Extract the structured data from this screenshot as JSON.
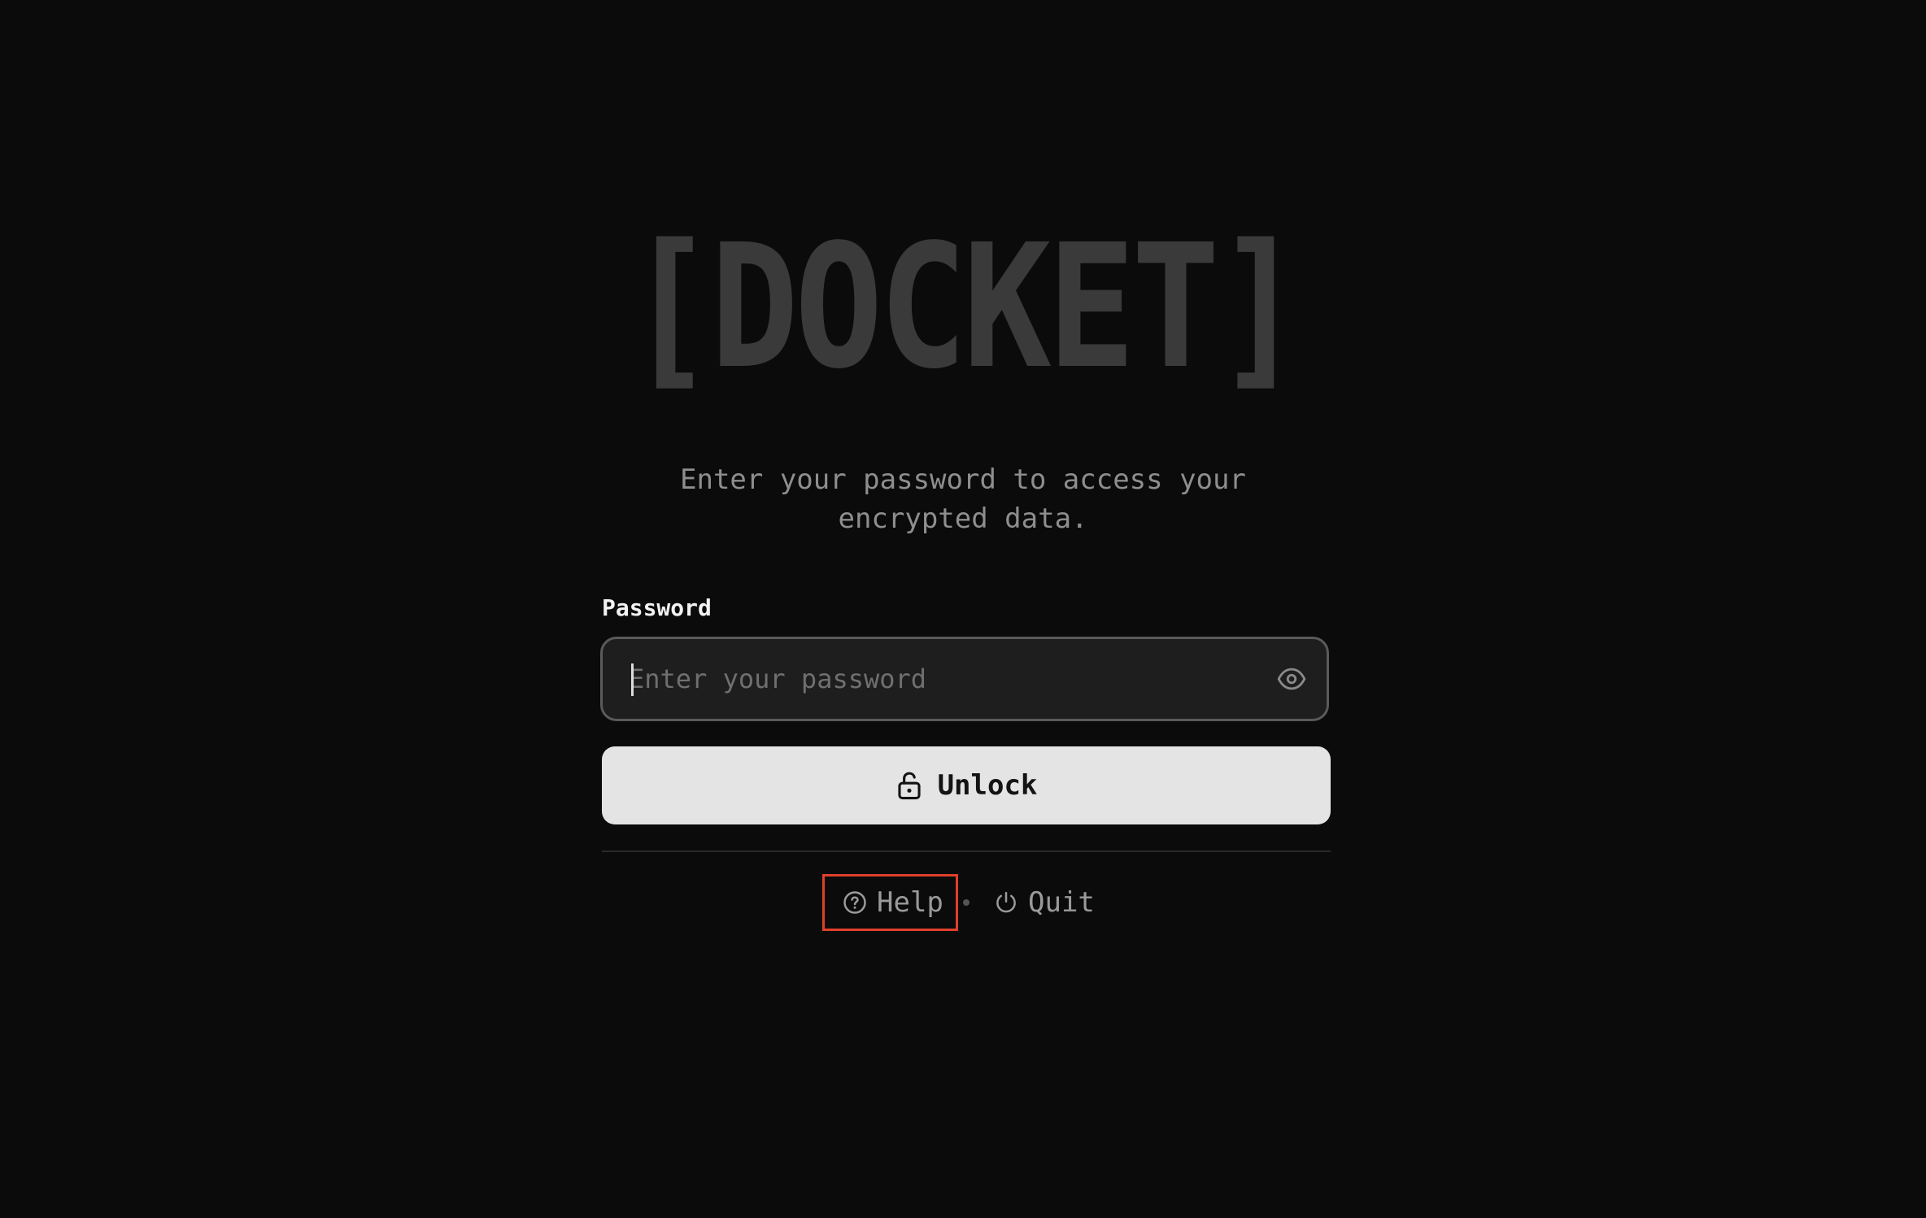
{
  "app": {
    "logo_text": "[DOCKET]"
  },
  "login": {
    "subtitle": "Enter your password to access your encrypted data.",
    "password_label": "Password",
    "password_placeholder": "Enter your password",
    "password_value": "",
    "unlock_label": "Unlock"
  },
  "footer": {
    "help_label": "Help",
    "quit_label": "Quit",
    "separator": "•"
  },
  "colors": {
    "background": "#0b0b0b",
    "logo": "#3a3a3a",
    "button_bg": "#e4e4e4",
    "highlight": "#e0402a"
  }
}
